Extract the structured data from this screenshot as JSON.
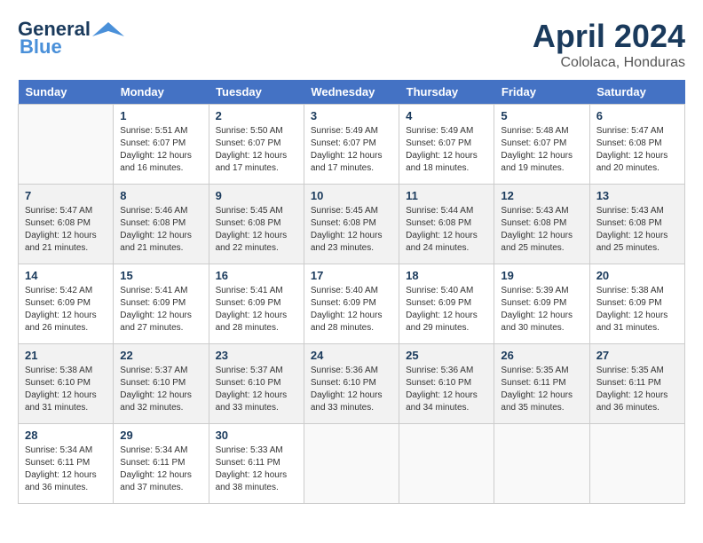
{
  "header": {
    "logo_line1": "General",
    "logo_line2": "Blue",
    "month": "April 2024",
    "location": "Cololaca, Honduras"
  },
  "columns": [
    "Sunday",
    "Monday",
    "Tuesday",
    "Wednesday",
    "Thursday",
    "Friday",
    "Saturday"
  ],
  "weeks": [
    [
      {
        "day": "",
        "info": ""
      },
      {
        "day": "1",
        "info": "Sunrise: 5:51 AM\nSunset: 6:07 PM\nDaylight: 12 hours\nand 16 minutes."
      },
      {
        "day": "2",
        "info": "Sunrise: 5:50 AM\nSunset: 6:07 PM\nDaylight: 12 hours\nand 17 minutes."
      },
      {
        "day": "3",
        "info": "Sunrise: 5:49 AM\nSunset: 6:07 PM\nDaylight: 12 hours\nand 17 minutes."
      },
      {
        "day": "4",
        "info": "Sunrise: 5:49 AM\nSunset: 6:07 PM\nDaylight: 12 hours\nand 18 minutes."
      },
      {
        "day": "5",
        "info": "Sunrise: 5:48 AM\nSunset: 6:07 PM\nDaylight: 12 hours\nand 19 minutes."
      },
      {
        "day": "6",
        "info": "Sunrise: 5:47 AM\nSunset: 6:08 PM\nDaylight: 12 hours\nand 20 minutes."
      }
    ],
    [
      {
        "day": "7",
        "info": "Sunrise: 5:47 AM\nSunset: 6:08 PM\nDaylight: 12 hours\nand 21 minutes."
      },
      {
        "day": "8",
        "info": "Sunrise: 5:46 AM\nSunset: 6:08 PM\nDaylight: 12 hours\nand 21 minutes."
      },
      {
        "day": "9",
        "info": "Sunrise: 5:45 AM\nSunset: 6:08 PM\nDaylight: 12 hours\nand 22 minutes."
      },
      {
        "day": "10",
        "info": "Sunrise: 5:45 AM\nSunset: 6:08 PM\nDaylight: 12 hours\nand 23 minutes."
      },
      {
        "day": "11",
        "info": "Sunrise: 5:44 AM\nSunset: 6:08 PM\nDaylight: 12 hours\nand 24 minutes."
      },
      {
        "day": "12",
        "info": "Sunrise: 5:43 AM\nSunset: 6:08 PM\nDaylight: 12 hours\nand 25 minutes."
      },
      {
        "day": "13",
        "info": "Sunrise: 5:43 AM\nSunset: 6:08 PM\nDaylight: 12 hours\nand 25 minutes."
      }
    ],
    [
      {
        "day": "14",
        "info": "Sunrise: 5:42 AM\nSunset: 6:09 PM\nDaylight: 12 hours\nand 26 minutes."
      },
      {
        "day": "15",
        "info": "Sunrise: 5:41 AM\nSunset: 6:09 PM\nDaylight: 12 hours\nand 27 minutes."
      },
      {
        "day": "16",
        "info": "Sunrise: 5:41 AM\nSunset: 6:09 PM\nDaylight: 12 hours\nand 28 minutes."
      },
      {
        "day": "17",
        "info": "Sunrise: 5:40 AM\nSunset: 6:09 PM\nDaylight: 12 hours\nand 28 minutes."
      },
      {
        "day": "18",
        "info": "Sunrise: 5:40 AM\nSunset: 6:09 PM\nDaylight: 12 hours\nand 29 minutes."
      },
      {
        "day": "19",
        "info": "Sunrise: 5:39 AM\nSunset: 6:09 PM\nDaylight: 12 hours\nand 30 minutes."
      },
      {
        "day": "20",
        "info": "Sunrise: 5:38 AM\nSunset: 6:09 PM\nDaylight: 12 hours\nand 31 minutes."
      }
    ],
    [
      {
        "day": "21",
        "info": "Sunrise: 5:38 AM\nSunset: 6:10 PM\nDaylight: 12 hours\nand 31 minutes."
      },
      {
        "day": "22",
        "info": "Sunrise: 5:37 AM\nSunset: 6:10 PM\nDaylight: 12 hours\nand 32 minutes."
      },
      {
        "day": "23",
        "info": "Sunrise: 5:37 AM\nSunset: 6:10 PM\nDaylight: 12 hours\nand 33 minutes."
      },
      {
        "day": "24",
        "info": "Sunrise: 5:36 AM\nSunset: 6:10 PM\nDaylight: 12 hours\nand 33 minutes."
      },
      {
        "day": "25",
        "info": "Sunrise: 5:36 AM\nSunset: 6:10 PM\nDaylight: 12 hours\nand 34 minutes."
      },
      {
        "day": "26",
        "info": "Sunrise: 5:35 AM\nSunset: 6:11 PM\nDaylight: 12 hours\nand 35 minutes."
      },
      {
        "day": "27",
        "info": "Sunrise: 5:35 AM\nSunset: 6:11 PM\nDaylight: 12 hours\nand 36 minutes."
      }
    ],
    [
      {
        "day": "28",
        "info": "Sunrise: 5:34 AM\nSunset: 6:11 PM\nDaylight: 12 hours\nand 36 minutes."
      },
      {
        "day": "29",
        "info": "Sunrise: 5:34 AM\nSunset: 6:11 PM\nDaylight: 12 hours\nand 37 minutes."
      },
      {
        "day": "30",
        "info": "Sunrise: 5:33 AM\nSunset: 6:11 PM\nDaylight: 12 hours\nand 38 minutes."
      },
      {
        "day": "",
        "info": ""
      },
      {
        "day": "",
        "info": ""
      },
      {
        "day": "",
        "info": ""
      },
      {
        "day": "",
        "info": ""
      }
    ]
  ]
}
